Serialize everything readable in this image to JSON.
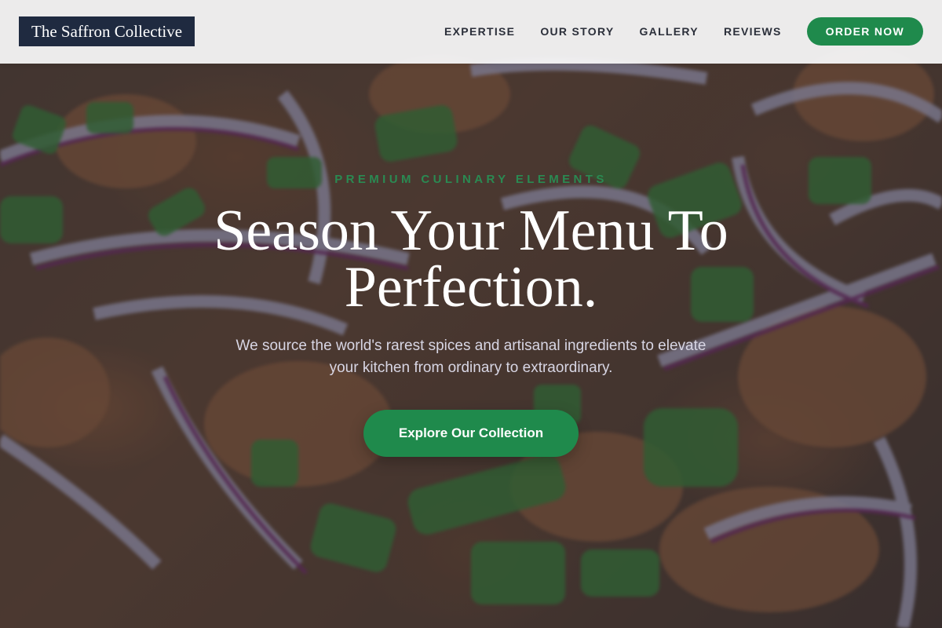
{
  "brand": {
    "name": "The Saffron Collective"
  },
  "nav": {
    "items": [
      {
        "label": "EXPERTISE"
      },
      {
        "label": "OUR STORY"
      },
      {
        "label": "GALLERY"
      },
      {
        "label": "REVIEWS"
      }
    ],
    "cta_label": "ORDER NOW"
  },
  "hero": {
    "eyebrow": "PREMIUM CULINARY ELEMENTS",
    "headline_line1": "Season Your Menu To",
    "headline_line2": "Perfection.",
    "subtitle_line1": "We source the world's rarest spices and artisanal ingredients to elevate",
    "subtitle_line2": "your kitchen from ordinary to extraordinary.",
    "cta_label": "Explore Our Collection",
    "background_image": "food-photo-curry-with-red-onion-and-green-onion"
  },
  "colors": {
    "brand_dark": "#1f2a40",
    "accent_green": "#1f8a4c",
    "nav_text": "#2b2f3a",
    "nav_bg": "#f5f5f7"
  }
}
